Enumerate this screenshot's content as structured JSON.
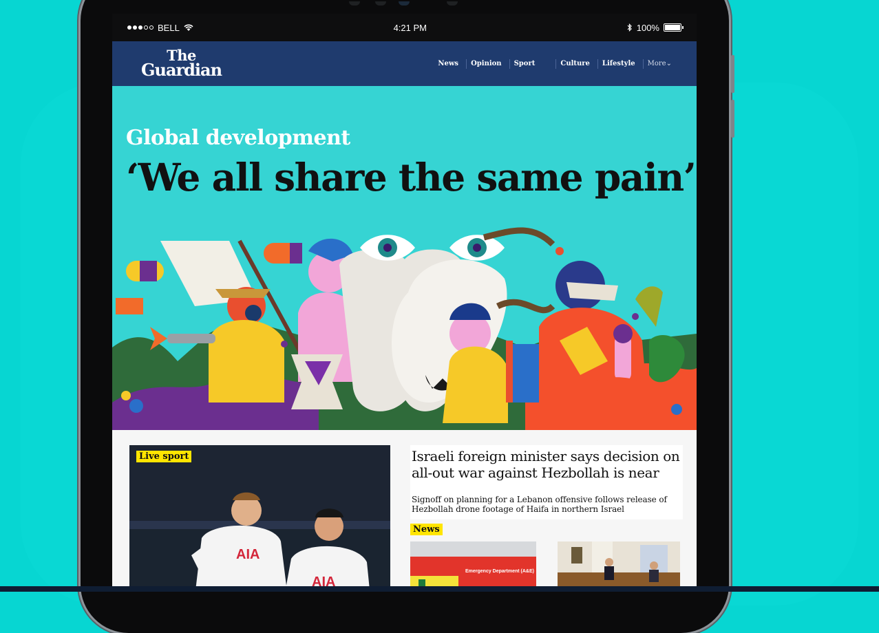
{
  "status_bar": {
    "carrier": "BELL",
    "time": "4:21 PM",
    "battery": "100%"
  },
  "masthead": {
    "logo_line1": "The",
    "logo_line2": "Guardian",
    "nav": [
      {
        "label": "News"
      },
      {
        "label": "Opinion"
      },
      {
        "label": "Sport"
      },
      {
        "label": "Culture"
      },
      {
        "label": "Lifestyle"
      }
    ],
    "more_label": "More"
  },
  "hero": {
    "kicker": "Global development",
    "headline": "‘We all share the same pain’"
  },
  "sport_card": {
    "tag": "Live sport",
    "shirt_sponsor": "AIA"
  },
  "top_story": {
    "headline": "Israeli foreign minister says decision on all-out war against Hezbollah is near",
    "standfirst": "Signoff on planning for a Lebanon offensive follows release of Hezbollah drone footage of Haifa in northern Israel"
  },
  "news_section": {
    "tag": "News",
    "ambulance_sign": "Emergency Department (A&E)"
  },
  "colors": {
    "page_bg": "#07d6d2",
    "masthead": "#1f3b6e",
    "hero_bg": "#36d4d3",
    "tag_yellow": "#ffe500"
  }
}
